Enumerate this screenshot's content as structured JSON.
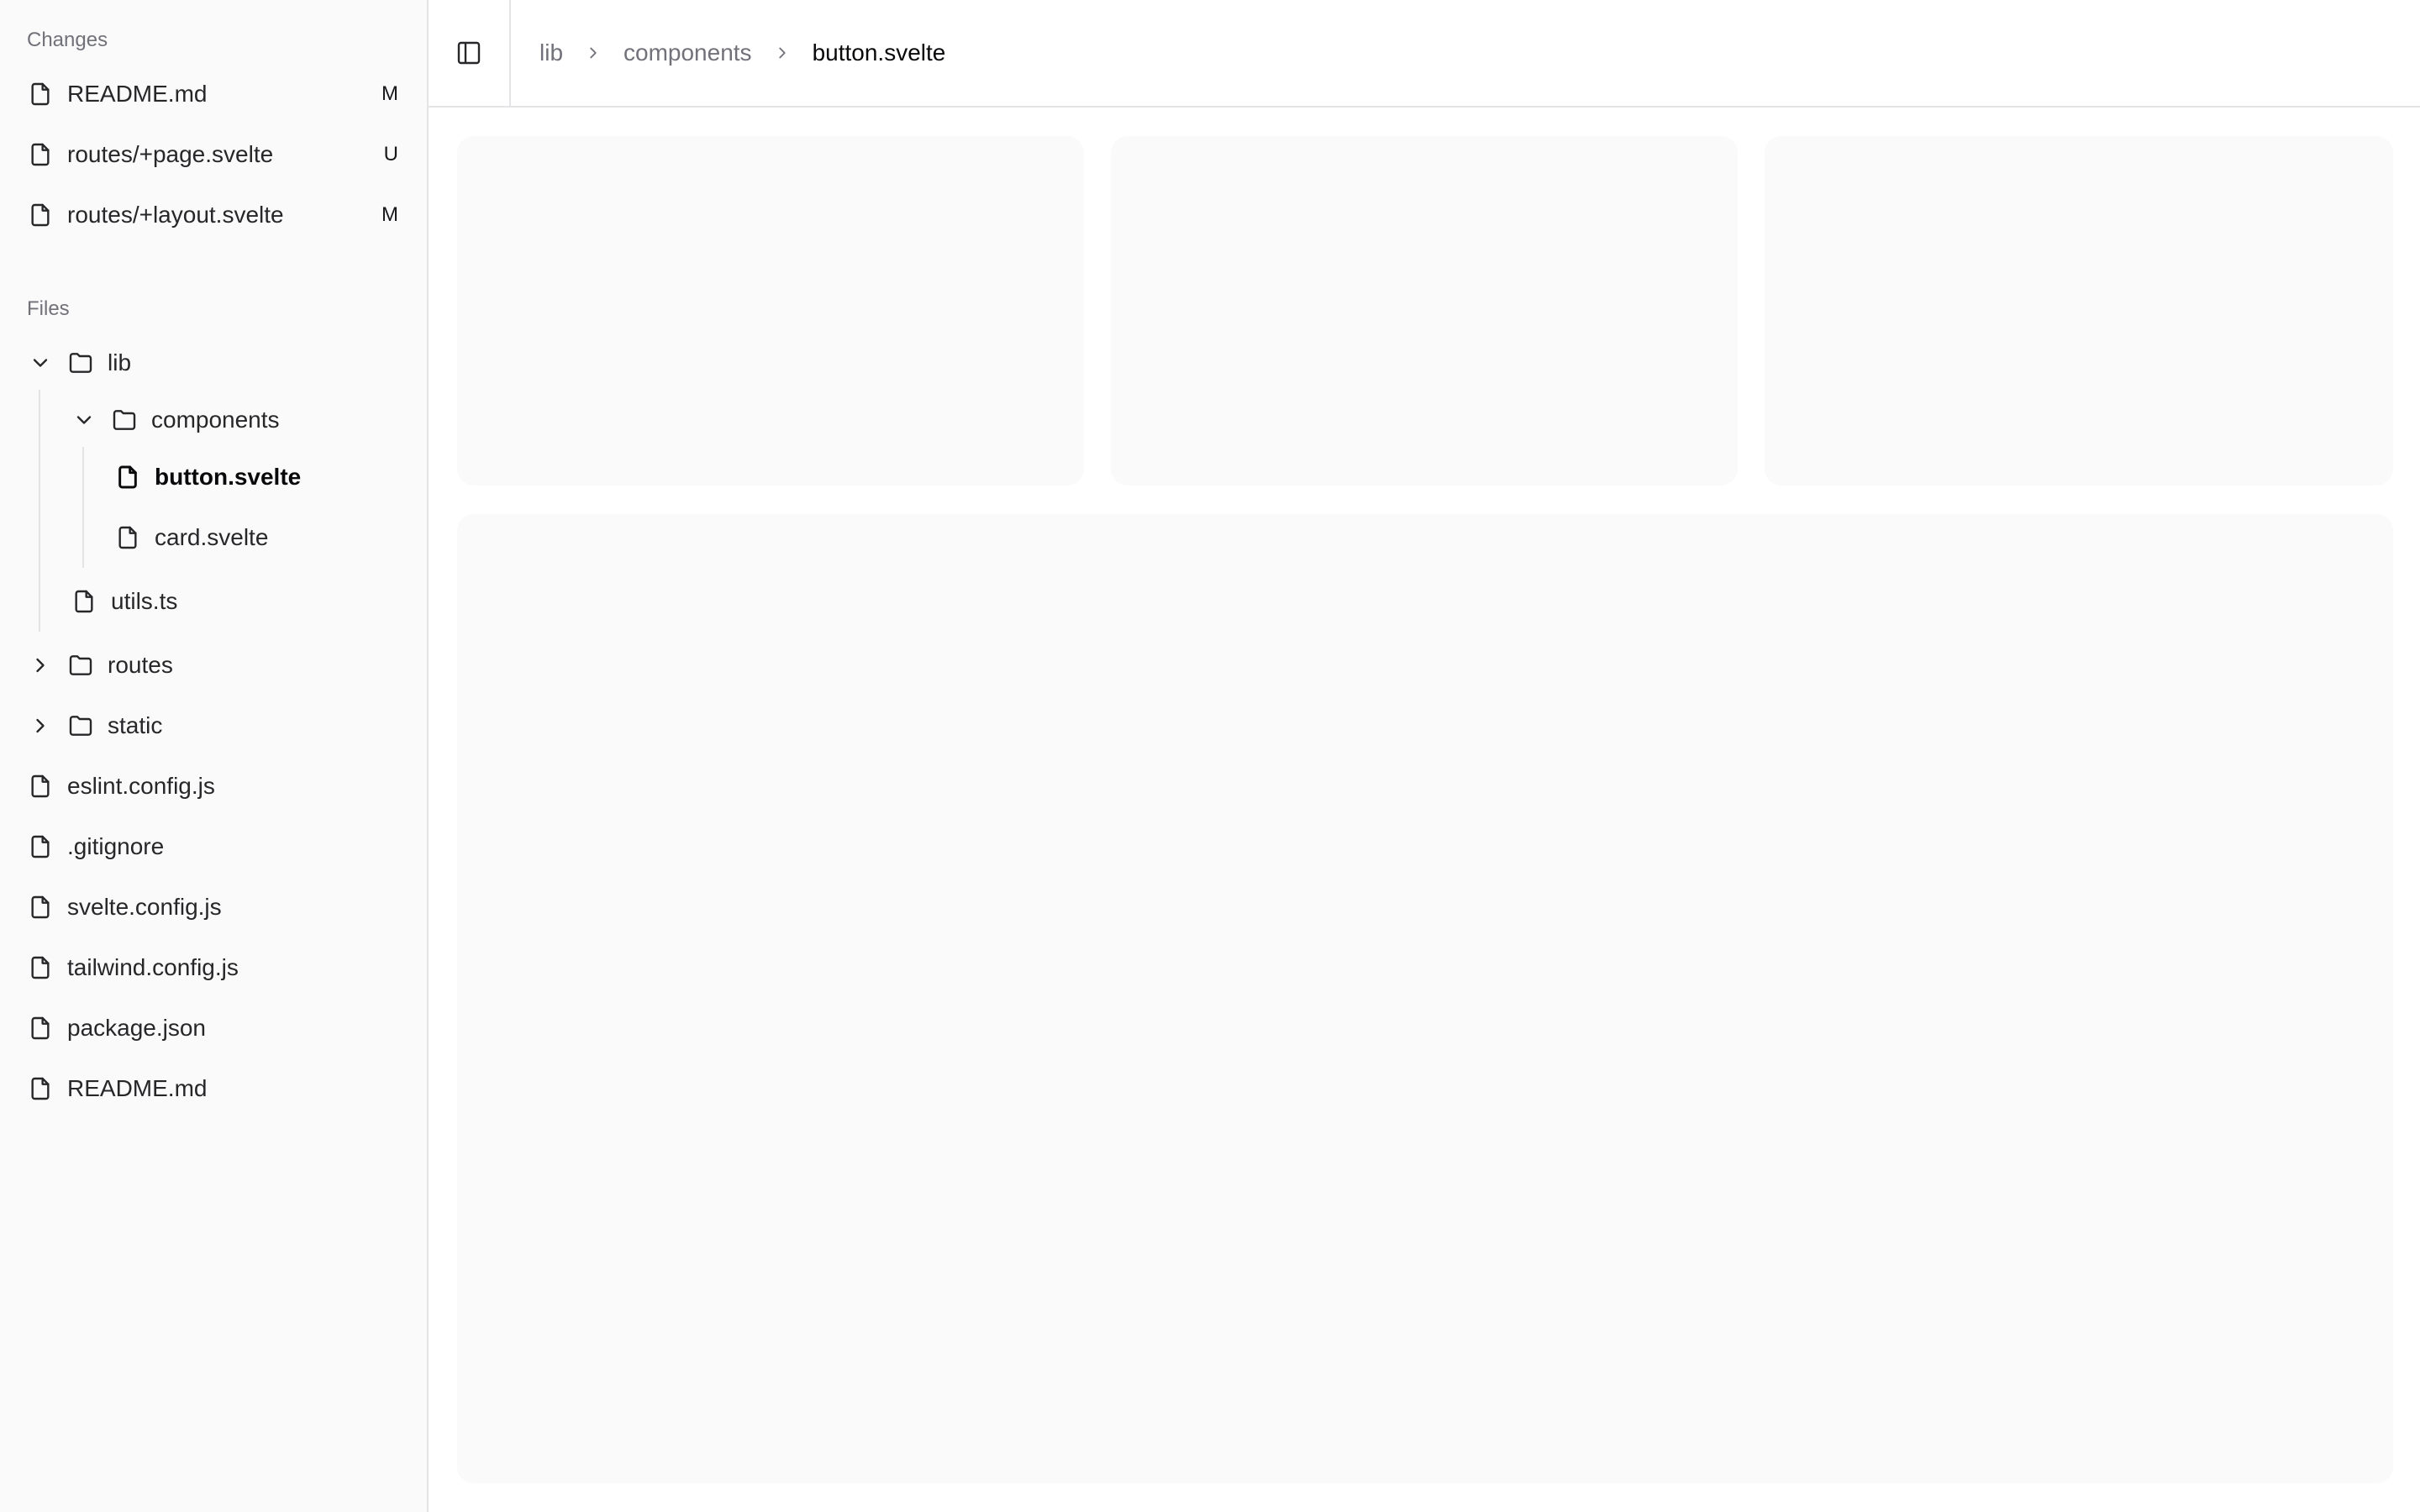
{
  "sidebar": {
    "changes_label": "Changes",
    "changes": [
      {
        "name": "README.md",
        "status": "M"
      },
      {
        "name": "routes/+page.svelte",
        "status": "U"
      },
      {
        "name": "routes/+layout.svelte",
        "status": "M"
      }
    ],
    "files_label": "Files",
    "tree": {
      "lib": "lib",
      "components": "components",
      "button": "button.svelte",
      "card": "card.svelte",
      "utils": "utils.ts",
      "routes": "routes",
      "static": "static",
      "eslint": "eslint.config.js",
      "gitignore": ".gitignore",
      "svelte_config": "svelte.config.js",
      "tailwind_config": "tailwind.config.js",
      "package_json": "package.json",
      "readme": "README.md"
    }
  },
  "header": {
    "breadcrumb": [
      "lib",
      "components",
      "button.svelte"
    ]
  },
  "icons": {
    "file": "file-icon",
    "folder": "folder-icon",
    "chevron_down": "chevron-down-icon",
    "chevron_right": "chevron-right-icon",
    "sidebar_toggle": "panel-left-icon"
  },
  "colors": {
    "sidebar_bg": "#fafafa",
    "border": "#e4e4e7",
    "muted_text": "#71717a",
    "text": "#27272a",
    "card_bg": "#fafafa"
  }
}
